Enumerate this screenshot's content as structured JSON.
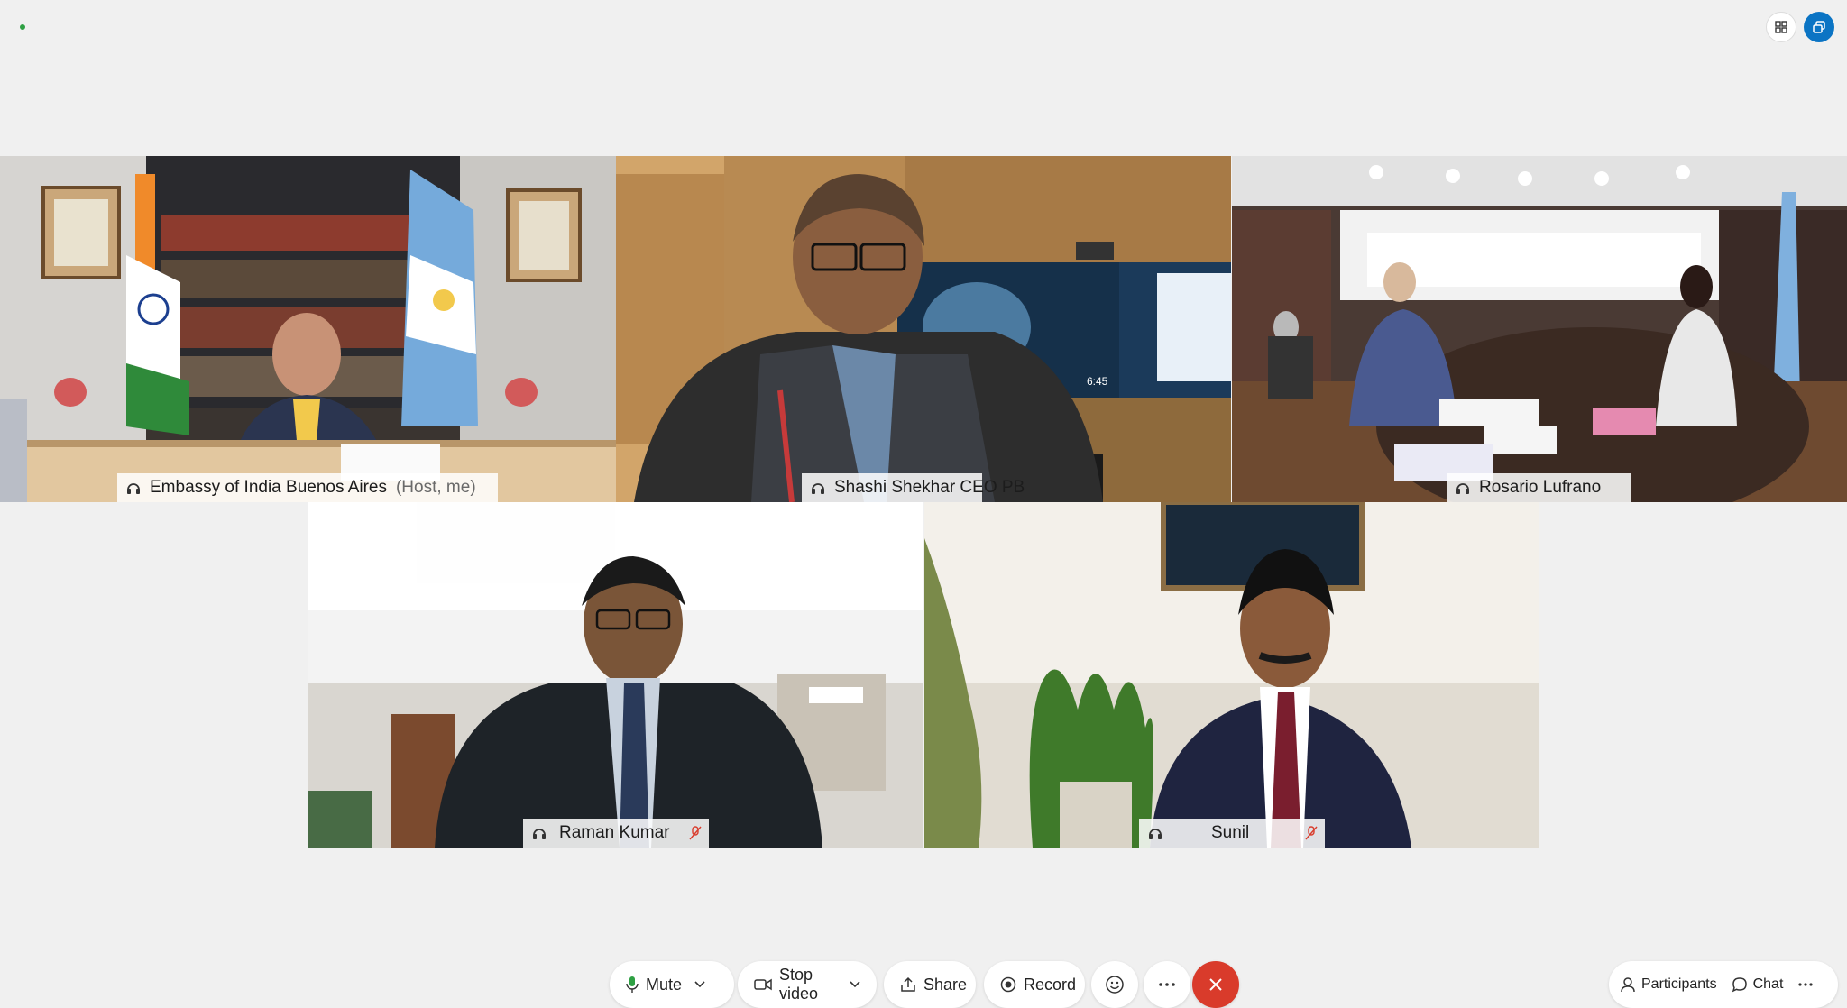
{
  "window": {
    "top_buttons": [
      {
        "name": "layout-grid-icon"
      },
      {
        "name": "popout-window-icon"
      }
    ]
  },
  "participants": [
    {
      "name": "Embassy of India Buenos Aires",
      "role": "(Host, me)",
      "active": true,
      "muted": false
    },
    {
      "name": "Shashi Shekhar CEO PB",
      "role": "",
      "active": false,
      "muted": false
    },
    {
      "name": "Rosario Lufrano",
      "role": "",
      "active": false,
      "muted": false
    },
    {
      "name": "Raman Kumar",
      "role": "",
      "active": false,
      "muted": true
    },
    {
      "name": "Sunil",
      "role": "",
      "active": false,
      "muted": true
    }
  ],
  "tile_overlay": {
    "tv_clock": "6:45"
  },
  "controls": {
    "mute_label": "Mute",
    "stop_video_label": "Stop video",
    "share_label": "Share",
    "record_label": "Record",
    "participants_label": "Participants",
    "chat_label": "Chat"
  },
  "colors": {
    "active_border": "#1ea7e6",
    "end_call": "#d93b2b",
    "mute_mic": "#2ea043",
    "popout_button": "#0b74c4",
    "muted_indicator": "#d93b2b"
  }
}
